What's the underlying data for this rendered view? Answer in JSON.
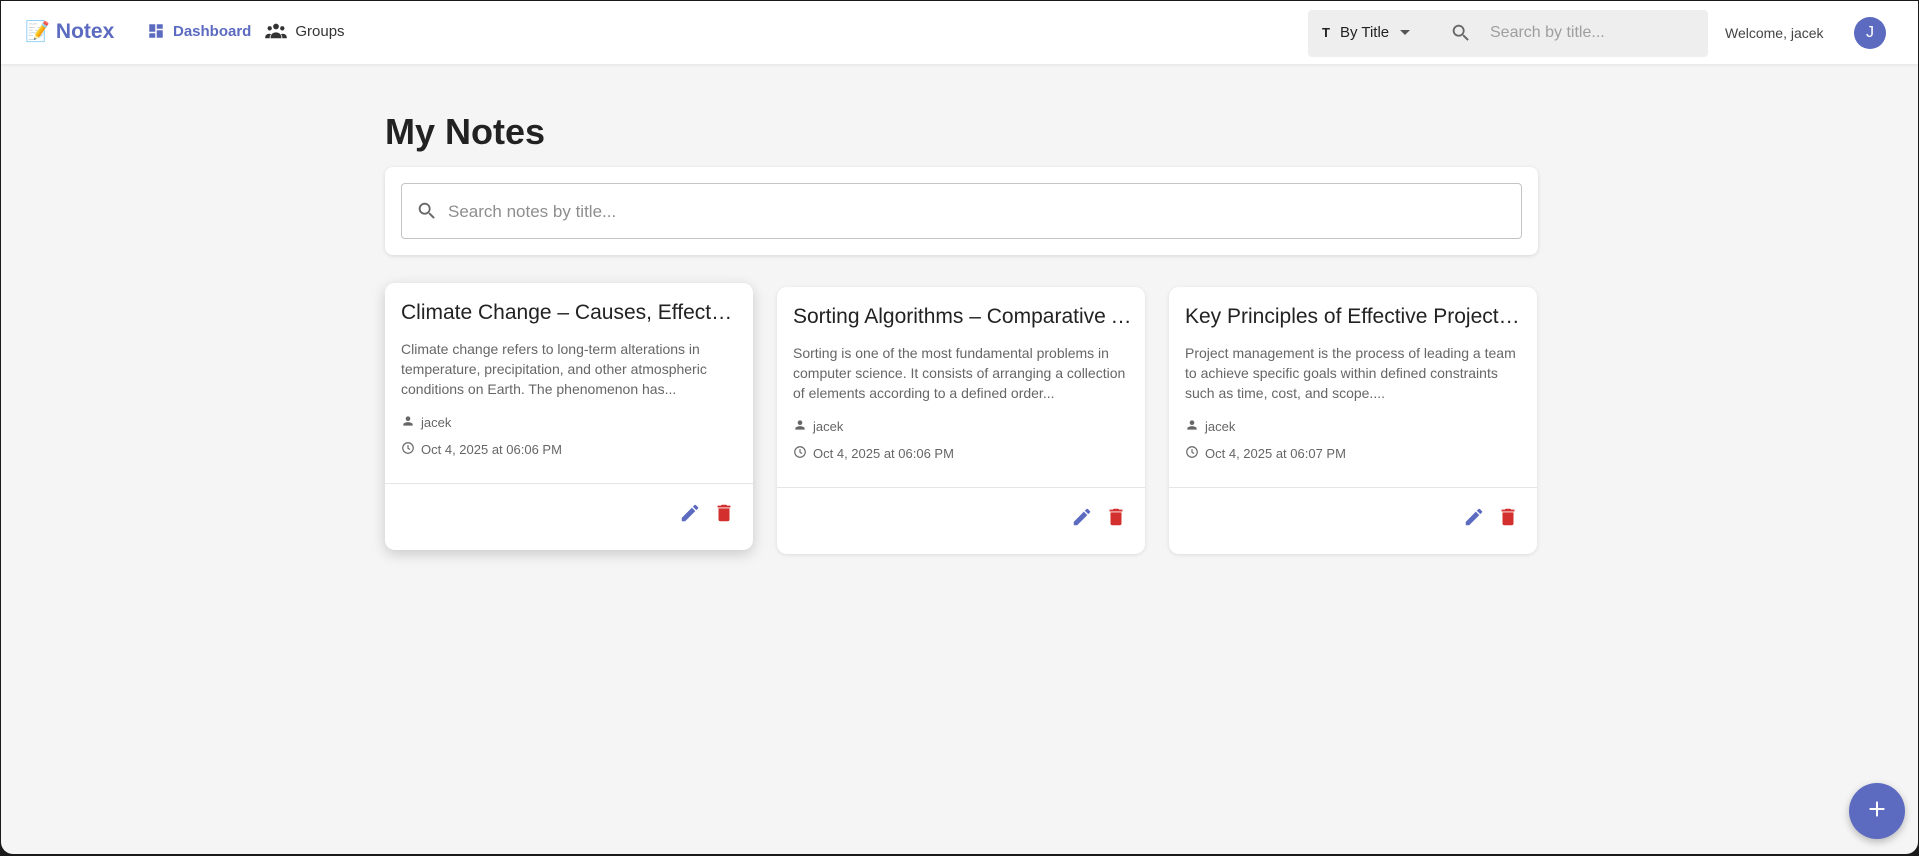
{
  "app": {
    "brand_emoji": "📝",
    "brand_name": "Notex"
  },
  "nav": {
    "dashboard_label": "Dashboard",
    "groups_label": "Groups"
  },
  "toolbar": {
    "sort_label": "By Title",
    "sort_icon_text": "T",
    "search_placeholder": "Search by title..."
  },
  "user": {
    "welcome_text": "Welcome, jacek",
    "avatar_initial": "J"
  },
  "main": {
    "title": "My Notes",
    "search_placeholder": "Search notes by title..."
  },
  "notes": [
    {
      "title": "Climate Change – Causes, Effects, and Solutions",
      "excerpt": "Climate change refers to long-term alterations in temperature, precipitation, and other atmospheric conditions on Earth. The phenomenon has...",
      "author": "jacek",
      "date": "Oct 4, 2025 at 06:06 PM"
    },
    {
      "title": "Sorting Algorithms – Comparative Analysis",
      "excerpt": "Sorting is one of the most fundamental problems in computer science. It consists of arranging a collection of elements according to a defined order...",
      "author": "jacek",
      "date": "Oct 4, 2025 at 06:06 PM"
    },
    {
      "title": "Key Principles of Effective Project Management",
      "excerpt": "Project management is the process of leading a team to achieve specific goals within defined constraints such as time, cost, and scope....",
      "author": "jacek",
      "date": "Oct 4, 2025 at 06:07 PM"
    }
  ],
  "colors": {
    "accent": "#5c6bc0",
    "delete": "#d32f2f",
    "background": "#f5f5f5"
  }
}
